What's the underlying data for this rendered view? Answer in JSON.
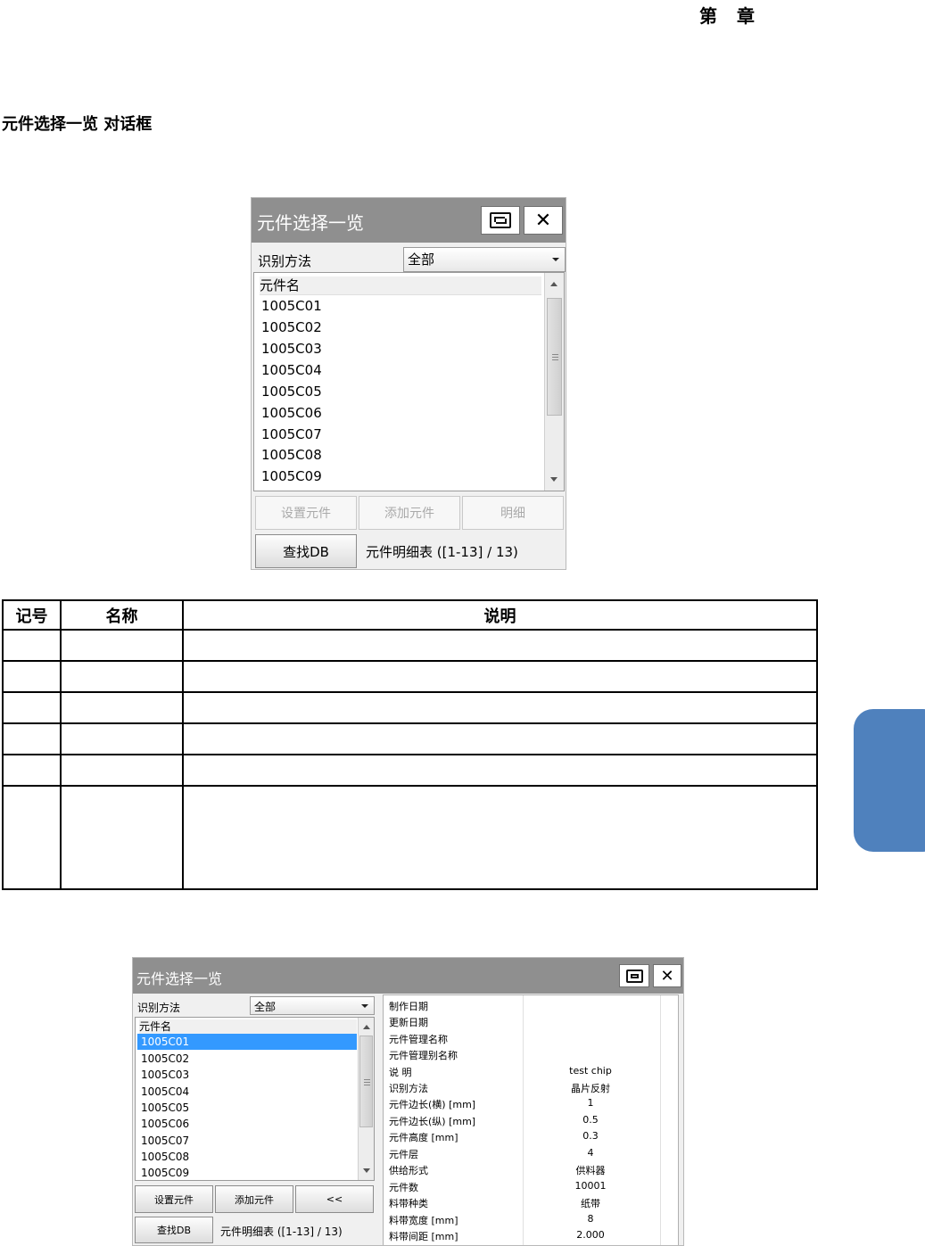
{
  "page": {
    "chapter": "第　章",
    "section_title": "元件选择一览 对话框",
    "accent_color": "#4f81bd"
  },
  "dialog1": {
    "title": "元件选择一览",
    "maximize_icon": "maximize-icon",
    "close_glyph": "✕",
    "method_label": "识别方法",
    "method_value": "全部",
    "list_header": "元件名",
    "items": [
      "1005C01",
      "1005C02",
      "1005C03",
      "1005C04",
      "1005C05",
      "1005C06",
      "1005C07",
      "1005C08",
      "1005C09"
    ],
    "buttons": [
      "设置元件",
      "添加元件",
      "明细"
    ],
    "find_db": "查找DB",
    "status": "元件明细表 ([1-13] / 13)"
  },
  "table": {
    "headers": [
      "记号",
      "名称",
      "说明"
    ]
  },
  "dialog2": {
    "title": "元件选择一览",
    "close_glyph": "✕",
    "method_label": "识别方法",
    "method_value": "全部",
    "list_header": "元件名",
    "items": [
      "1005C01",
      "1005C02",
      "1005C03",
      "1005C04",
      "1005C05",
      "1005C06",
      "1005C07",
      "1005C08",
      "1005C09"
    ],
    "selected_index": 0,
    "buttons": [
      "设置元件",
      "添加元件",
      "<<"
    ],
    "find_db": "查找DB",
    "status": "元件明细表 ([1-13] / 13)",
    "properties": [
      {
        "key": "制作日期",
        "value": ""
      },
      {
        "key": "更新日期",
        "value": ""
      },
      {
        "key": "元件管理名称",
        "value": ""
      },
      {
        "key": "元件管理别名称",
        "value": ""
      },
      {
        "key": "说 明",
        "value": "test chip"
      },
      {
        "key": "识别方法",
        "value": "晶片反射"
      },
      {
        "key": "元件边长(横) [mm]",
        "value": "1"
      },
      {
        "key": "元件边长(纵) [mm]",
        "value": "0.5"
      },
      {
        "key": "元件高度 [mm]",
        "value": "0.3"
      },
      {
        "key": "元件层",
        "value": "4"
      },
      {
        "key": "供给形式",
        "value": "供料器"
      },
      {
        "key": "元件数",
        "value": "10001"
      },
      {
        "key": "料带种类",
        "value": "纸带"
      },
      {
        "key": "料带宽度 [mm]",
        "value": "8"
      },
      {
        "key": "料带间距 [mm]",
        "value": "2.000"
      }
    ]
  }
}
